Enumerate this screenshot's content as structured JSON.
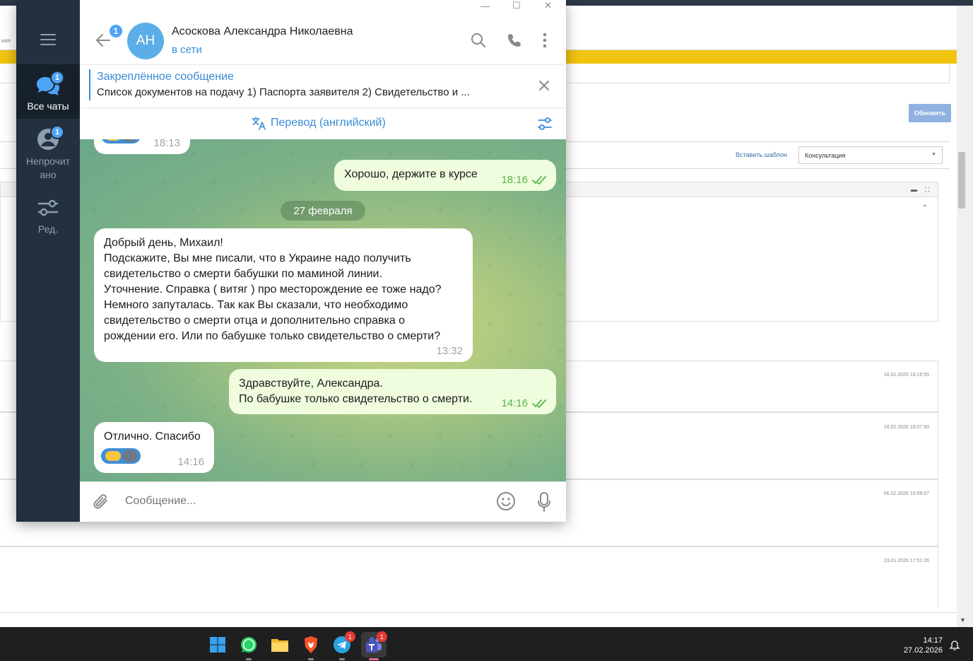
{
  "background_app": {
    "tab_fragment": "ния",
    "refresh_button": "Обновить",
    "insert_template_link": "Вставить шаблон",
    "template_select_value": "Консультация",
    "rows": [
      {
        "date": "18.02.2026 18:16:55"
      },
      {
        "date": "18.02.2026 18:07:50"
      },
      {
        "date": "06.02.2026 10:08:07"
      },
      {
        "date": "23.01.2026 17:51:26"
      }
    ]
  },
  "telegram": {
    "left_rail": {
      "items": [
        {
          "label": "Все чаты",
          "badge": "1",
          "icon": "chats-icon"
        },
        {
          "label": "Непрочит ано",
          "badge": "1",
          "icon": "unread-icon"
        },
        {
          "label": "Ред.",
          "icon": "edit-filters-icon"
        }
      ]
    },
    "header": {
      "back_badge": "1",
      "avatar_initials": "АН",
      "name": "Асоскова Александра Николаевна",
      "status": "в сети"
    },
    "pinned": {
      "title": "Закреплённое сообщение",
      "text": "Список документов на подачу  1) Паспорта заявителя 2) Свидетельство и ..."
    },
    "translate_bar": {
      "label": "Перевод (английский)"
    },
    "messages": [
      {
        "direction": "in",
        "time": "18:13",
        "sticker": true
      },
      {
        "direction": "out",
        "text": "Хорошо, держите в курсе",
        "time": "18:16",
        "read": true
      },
      {
        "type": "date",
        "text": "27 февраля"
      },
      {
        "direction": "in",
        "lines": [
          "Добрый день, Михаил!",
          "Подскажите, Вы мне писали, что в Украине надо получить",
          "свидетельство о смерти бабушки по маминой линии.",
          "Уточнение. Справка ( витяг ) про месторождение ее тоже надо?",
          "Немного запуталась. Так как Вы сказали, что необходимо",
          "свидетельство о смерти отца и дополнительно справка о",
          "рождении его. Или по бабушке только свидетельство о смерти?"
        ],
        "time": "13:32"
      },
      {
        "direction": "out",
        "lines": [
          "Здравствуйте, Александра.",
          "По бабушке только свидетельство о смерти."
        ],
        "time": "14:16",
        "read": true
      },
      {
        "direction": "in",
        "text": "Отлично. Спасибо",
        "time": "14:16",
        "sticker": true
      }
    ],
    "composer": {
      "placeholder": "Сообщение..."
    }
  },
  "taskbar": {
    "apps": [
      {
        "name": "windows-start-icon"
      },
      {
        "name": "whatsapp-icon"
      },
      {
        "name": "file-explorer-icon"
      },
      {
        "name": "brave-browser-icon"
      },
      {
        "name": "telegram-icon",
        "badge": "1"
      },
      {
        "name": "teams-icon",
        "badge": "1",
        "active": true
      }
    ],
    "clock_time": "14:17",
    "clock_date": "27.02.2026"
  },
  "colors": {
    "accent": "#3a8bd6",
    "rail": "#233040",
    "out_bubble": "#effdde",
    "read_check": "#58b349",
    "crm_yellow": "#f1c40f"
  }
}
